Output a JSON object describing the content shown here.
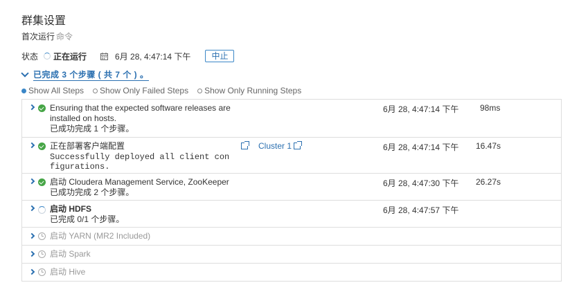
{
  "page": {
    "title": "群集设置",
    "subtitle_prefix": "首次运行",
    "subtitle_link": "命令"
  },
  "status": {
    "label": "状态",
    "state": "正在运行",
    "datetime": "6月 28, 4:47:14 下午",
    "abort_label": "中止"
  },
  "summary": {
    "text": "已完成 3 个步骤 ( 共 7 个 ) 。"
  },
  "filters": [
    {
      "label": "Show All Steps",
      "selected": true
    },
    {
      "label": "Show Only Failed Steps",
      "selected": false
    },
    {
      "label": "Show Only Running Steps",
      "selected": false
    }
  ],
  "steps": [
    {
      "status": "success",
      "name_line1": "Ensuring that the expected software releases are",
      "name_line2": "installed on hosts.",
      "detail": "已成功完成 1 个步骤。",
      "time": "6月 28, 4:47:14 下午",
      "duration": "98ms"
    },
    {
      "status": "success",
      "name": "正在部署客户端配置",
      "detail_line1": "Successfully deployed all client con",
      "detail_line2": "figurations.",
      "link_label": "Cluster 1",
      "time": "6月 28, 4:47:14 下午",
      "duration": "16.47s"
    },
    {
      "status": "success",
      "name": "启动 Cloudera Management Service, ZooKeeper",
      "detail": "已成功完成 2 个步骤。",
      "time": "6月 28, 4:47:30 下午",
      "duration": "26.27s"
    },
    {
      "status": "running",
      "name": "启动 HDFS",
      "detail": "已完成 0/1 个步骤。",
      "time": "6月 28, 4:47:57 下午",
      "duration": ""
    },
    {
      "status": "pending",
      "name": "启动 YARN (MR2 Included)"
    },
    {
      "status": "pending",
      "name": "启动 Spark"
    },
    {
      "status": "pending",
      "name": "启动 Hive"
    }
  ],
  "colors": {
    "accent": "#2a6fb0",
    "success": "#46a546",
    "border": "#dddddd",
    "muted": "#999999"
  },
  "icons": [
    "spinner-icon",
    "calendar-icon",
    "check-circle-icon",
    "clock-icon",
    "external-link-icon",
    "chevron-right-icon",
    "chevron-down-icon"
  ]
}
